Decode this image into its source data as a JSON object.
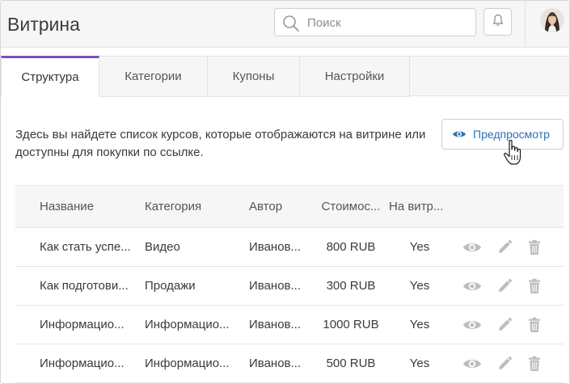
{
  "header": {
    "title": "Витрина",
    "search_placeholder": "Поиск"
  },
  "tabs": [
    {
      "label": "Структура",
      "active": true
    },
    {
      "label": "Категории",
      "active": false
    },
    {
      "label": "Купоны",
      "active": false
    },
    {
      "label": "Настройки",
      "active": false
    }
  ],
  "description": "Здесь вы найдете список курсов, которые отображаются на витрине или доступны для покупки по ссылке.",
  "preview_button": "Предпросмотр",
  "table": {
    "columns": [
      "Название",
      "Категория",
      "Автор",
      "Стоимос...",
      "На витр..."
    ],
    "rows": [
      {
        "name": "Как стать успе...",
        "category": "Видео",
        "author": "Иванов...",
        "price": "800 RUB",
        "visible": "Yes"
      },
      {
        "name": "Как подготови...",
        "category": "Продажи",
        "author": "Иванов...",
        "price": "300 RUB",
        "visible": "Yes"
      },
      {
        "name": "Информацио...",
        "category": "Информацио...",
        "author": "Иванов...",
        "price": "1000 RUB",
        "visible": "Yes"
      },
      {
        "name": "Информацио...",
        "category": "Информацио...",
        "author": "Иванов...",
        "price": "500 RUB",
        "visible": "Yes"
      }
    ]
  },
  "icons": {
    "search": "search-icon",
    "bell": "bell-icon",
    "avatar": "user-avatar",
    "preview": "eye-icon",
    "row_actions": [
      "eye-icon",
      "pencil-icon",
      "trash-icon"
    ]
  },
  "colors": {
    "accent_tab": "#7b4ec4",
    "link_blue": "#2f6fb0",
    "action_icon": "#b8b8b8",
    "header_bg": "#f6f6f6"
  }
}
